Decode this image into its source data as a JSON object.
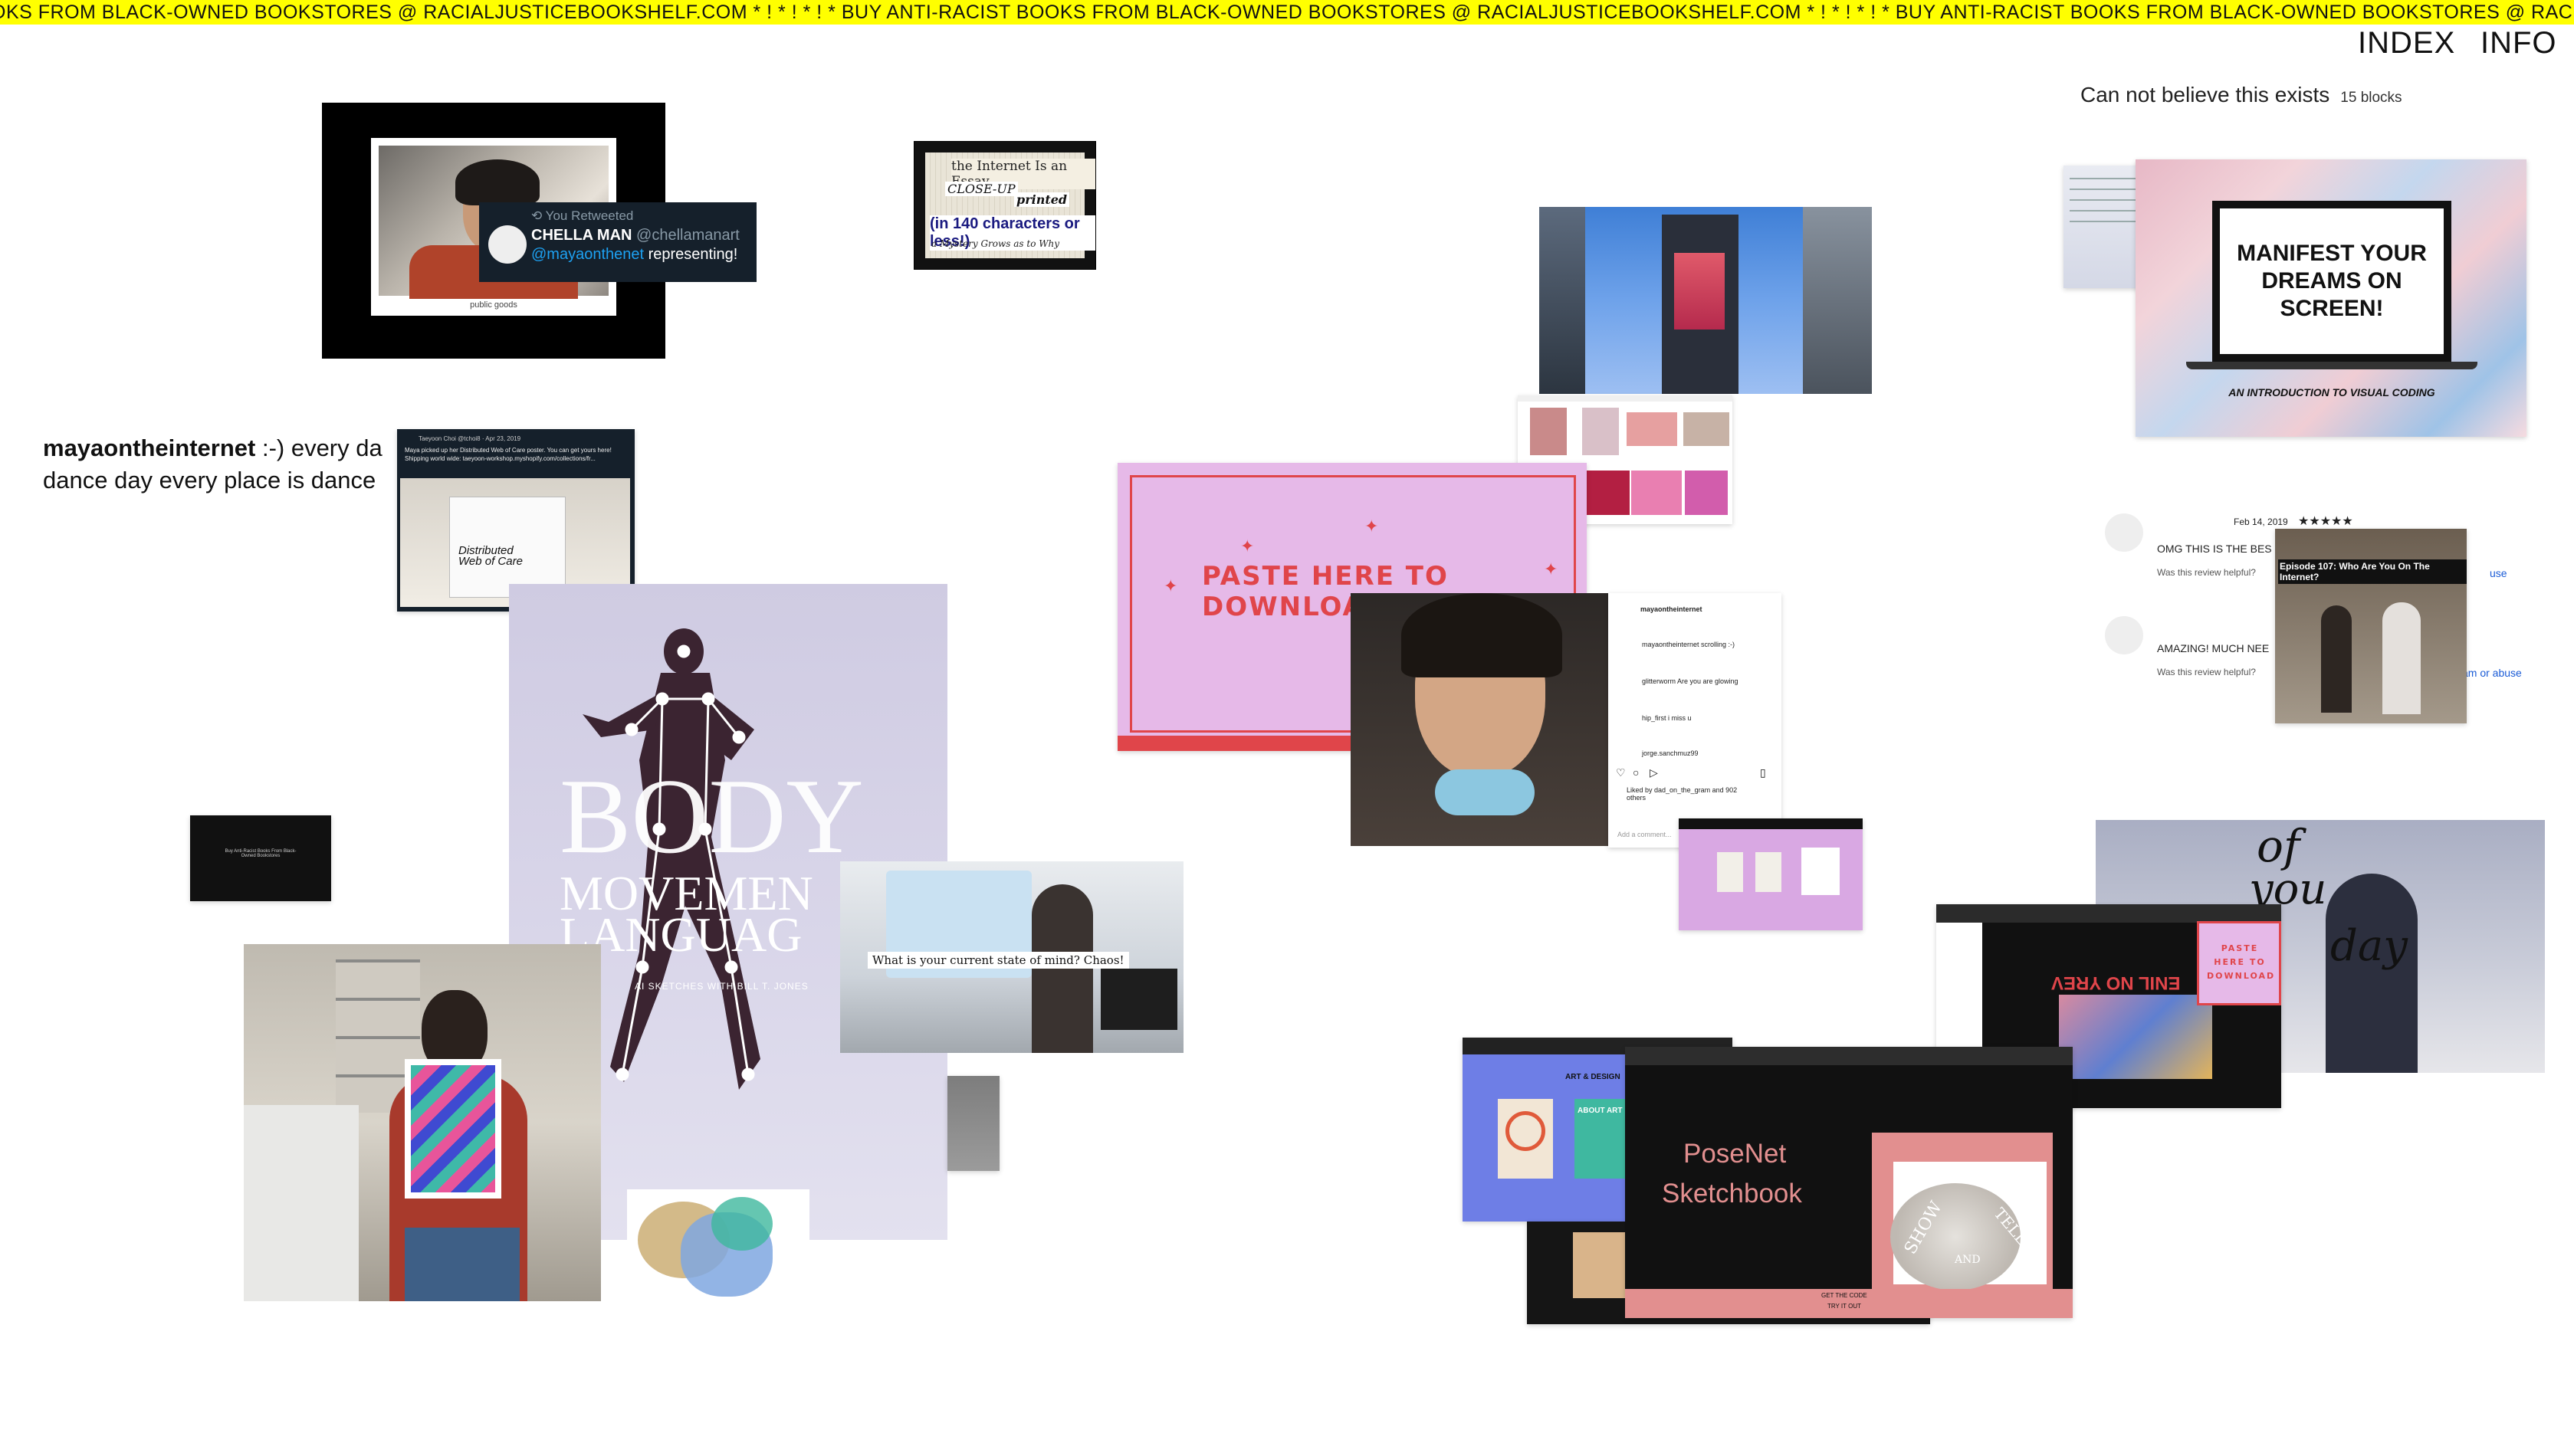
{
  "ticker": {
    "text": "OKS FROM BLACK-OWNED BOOKSTORES @ RACIALJUSTICEBOOKSHELF.COM * ! * ! * ! * BUY ANTI-RACIST BOOKS FROM BLACK-OWNED BOOKSTORES @ RACIALJUSTICEBOOKSHELF.COM * ! * ! * ! * BUY ANTI-RACIST BOOKS FROM BLACK-OWNED BOOKSTORES @ RACI"
  },
  "nav": {
    "index": "INDEX",
    "info": "INFO"
  },
  "channel": {
    "title": "Can not believe this exists",
    "count": "15 blocks"
  },
  "bio": {
    "name": "mayaontheinternet",
    "line1": " :-) every da",
    "line2": "dance day every place is dance"
  },
  "tweet": {
    "retweeted": "You Retweeted",
    "name": "CHELLA MAN",
    "handle": "@chellamanart",
    "mention": "@mayaonthenet",
    "text": " representing!",
    "caption": "public goods"
  },
  "collage": {
    "line1": "the Internet Is an Essay",
    "line2": "CLOSE-UP",
    "line3": "printed",
    "line4": "(in 140 characters or less!)",
    "line5": "a Mystery Grows as to Why"
  },
  "tweet2": {
    "header": "Taeyoon Choi @tchoi8 · Apr 23, 2019",
    "text": "Maya picked up her Distributed Web of Care poster. You can get yours here! Shipping world wide: taeyoon-workshop.myshopify.com/collections/fr...",
    "poster": "Distributed Web of Care"
  },
  "bookstore_card": {
    "text": "Buy Anti-Racist Books From Black-Owned Bookstores"
  },
  "body_movement": {
    "title1": "BODY",
    "title2": "MOVEMEN",
    "title3": "LANGUAG",
    "subtitle": "AI SKETCHES WITH BILL T. JONES"
  },
  "mind": {
    "question": "What is your current state of mind?",
    "answer": "Chaos!"
  },
  "paste": {
    "label": "PASTE HERE TO DOWNLOAD"
  },
  "manifest": {
    "line1": "MANIFEST YOUR",
    "line2": "DREAMS ON",
    "line3": "SCREEN!",
    "subtitle": "AN INTRODUCTION TO VISUAL CODING"
  },
  "instagram": {
    "user": "mayaontheinternet",
    "caption": "mayaontheinternet scrolling :-)",
    "c1": "glitterworm Are you are glowing",
    "c2": "hip_first i miss u",
    "c3": "jorge.sanchmuz99",
    "likes": "Liked by dad_on_the_gram and 902 others",
    "add": "Add a comment..."
  },
  "reviews": {
    "date": "Feb 14, 2019",
    "stars": "★★★★★",
    "r1": "OMG THIS IS THE BES",
    "helpful1": "Was this review helpful?",
    "r2": "AMAZING! MUCH NEE",
    "helpful2": "Was this review helpful?",
    "episode": "Episode 107: Who Are You On The Internet?",
    "use": "use",
    "abuse": "am or abuse"
  },
  "of_you": {
    "w1": "of",
    "w2": "you",
    "w3": "day"
  },
  "online": {
    "reversed": "ENIL NO YREV",
    "paste_small": "PASTE HERE TO DOWNLOAD"
  },
  "art_design": {
    "label": "ART & DESIGN",
    "about": "ABOUT ART"
  },
  "posenet": {
    "line1": "PoseNet",
    "line2": "Sketchbook",
    "show": "SHOW",
    "and": "AND",
    "tell": "TELL",
    "get_code": "GET THE CODE",
    "try_it": "TRY IT OUT"
  },
  "colors": {
    "ticker_bg": "#ffff00",
    "pink": "#e8b7e6",
    "paste_red": "#e0454a",
    "posenet_pink": "#e28f8f",
    "blue_card": "#6e7ee6"
  }
}
